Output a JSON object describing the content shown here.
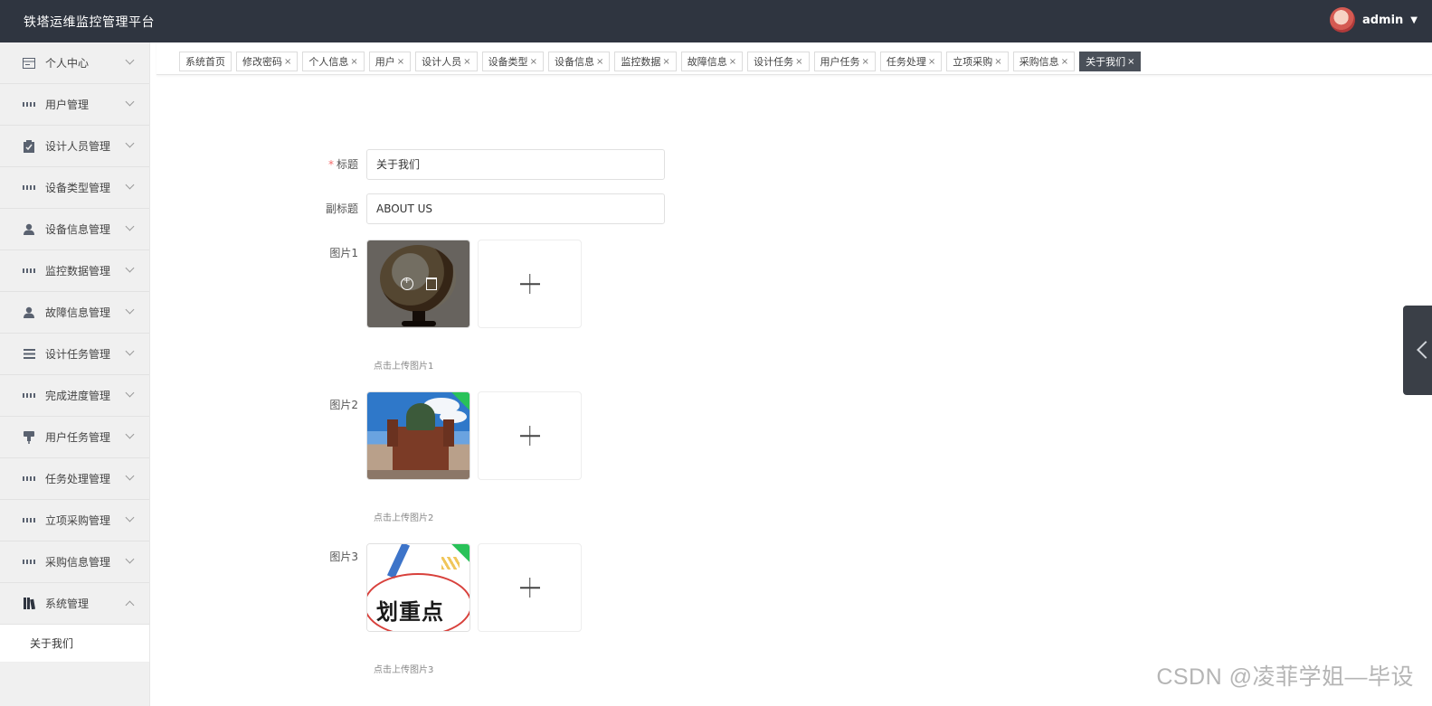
{
  "app": {
    "title": "铁塔运维监控管理平台"
  },
  "user": {
    "name": "admin",
    "dropdown_icon": "caret-down-icon"
  },
  "sidebar": {
    "items": [
      {
        "label": "个人中心",
        "icon": "id-card-icon"
      },
      {
        "label": "用户管理",
        "icon": "grid-icon"
      },
      {
        "label": "设计人员管理",
        "icon": "clipboard-icon"
      },
      {
        "label": "设备类型管理",
        "icon": "grid-icon"
      },
      {
        "label": "设备信息管理",
        "icon": "user-icon"
      },
      {
        "label": "监控数据管理",
        "icon": "grid-icon"
      },
      {
        "label": "故障信息管理",
        "icon": "user-icon"
      },
      {
        "label": "设计任务管理",
        "icon": "list-icon"
      },
      {
        "label": "完成进度管理",
        "icon": "grid-icon"
      },
      {
        "label": "用户任务管理",
        "icon": "pin-icon"
      },
      {
        "label": "任务处理管理",
        "icon": "grid-icon"
      },
      {
        "label": "立项采购管理",
        "icon": "grid-icon"
      },
      {
        "label": "采购信息管理",
        "icon": "grid-icon"
      },
      {
        "label": "系统管理",
        "icon": "book-icon",
        "expanded": true
      }
    ],
    "sub_items": [
      {
        "label": "关于我们"
      }
    ]
  },
  "tabs": [
    {
      "label": "系统首页",
      "closable": false
    },
    {
      "label": "修改密码",
      "closable": true
    },
    {
      "label": "个人信息",
      "closable": true
    },
    {
      "label": "用户",
      "closable": true
    },
    {
      "label": "设计人员",
      "closable": true
    },
    {
      "label": "设备类型",
      "closable": true
    },
    {
      "label": "设备信息",
      "closable": true
    },
    {
      "label": "监控数据",
      "closable": true
    },
    {
      "label": "故障信息",
      "closable": true
    },
    {
      "label": "设计任务",
      "closable": true
    },
    {
      "label": "用户任务",
      "closable": true
    },
    {
      "label": "任务处理",
      "closable": true
    },
    {
      "label": "立项采购",
      "closable": true
    },
    {
      "label": "采购信息",
      "closable": true
    },
    {
      "label": "关于我们",
      "closable": true,
      "active": true
    }
  ],
  "tab_close_glyph": "×",
  "form": {
    "title": {
      "label": "标题",
      "required_mark": "*",
      "value": "关于我们"
    },
    "subtitle": {
      "label": "副标题",
      "value": "ABOUT US"
    },
    "images": [
      {
        "label": "图片1",
        "tip": "点击上传图片1",
        "thumb": "globe"
      },
      {
        "label": "图片2",
        "tip": "点击上传图片2",
        "thumb": "church"
      },
      {
        "label": "图片3",
        "tip": "点击上传图片3",
        "thumb": "highlight",
        "thumb_text": "划重点"
      }
    ]
  },
  "watermark": "CSDN @凌菲学姐—毕设",
  "colors": {
    "header_bg": "#2f3540",
    "active_tab": "#4a5059",
    "required": "#f56c6c"
  }
}
